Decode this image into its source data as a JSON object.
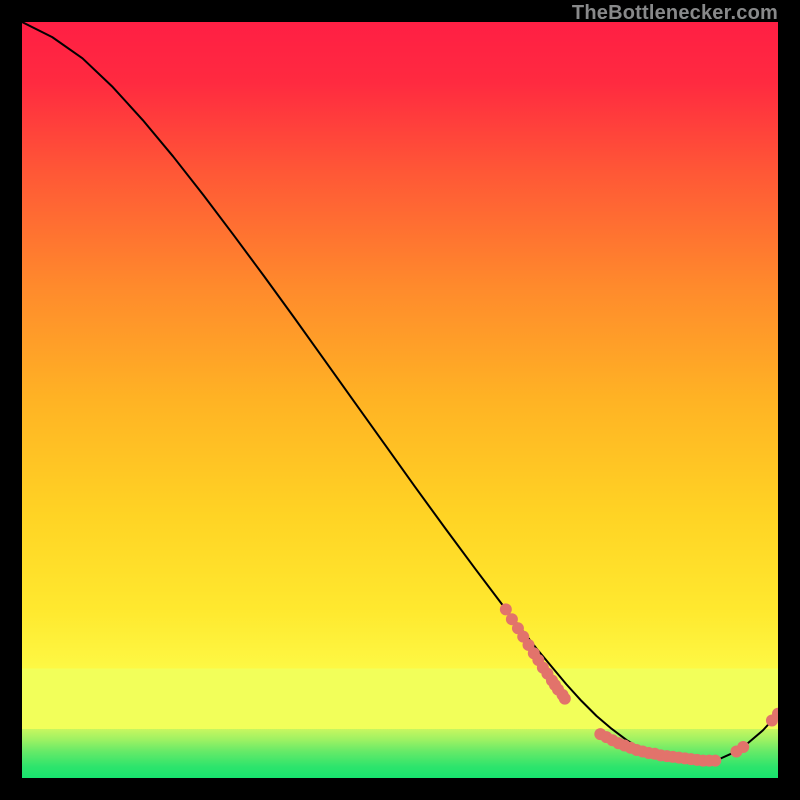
{
  "attribution": "TheBottlenecker.com",
  "chart_data": {
    "type": "line",
    "title": "",
    "xlabel": "",
    "ylabel": "",
    "xlim": [
      0,
      100
    ],
    "ylim": [
      0,
      100
    ],
    "grid": false,
    "background_gradient": {
      "top_color": "#ff1f44",
      "mid_color": "#ffd324",
      "low_band_color": "#f2ff5a",
      "bottom_color": "#17e36e"
    },
    "series": [
      {
        "name": "bottleneck-curve",
        "color": "#000000",
        "x": [
          0,
          4,
          8,
          12,
          16,
          20,
          24,
          28,
          32,
          36,
          40,
          44,
          48,
          52,
          56,
          60,
          64,
          68,
          72,
          74,
          76,
          78,
          80,
          82,
          84,
          86,
          88,
          90,
          92,
          94,
          96,
          98,
          100
        ],
        "y": [
          100,
          98.0,
          95.2,
          91.4,
          87.0,
          82.2,
          77.1,
          71.8,
          66.4,
          60.9,
          55.3,
          49.7,
          44.1,
          38.5,
          33.0,
          27.6,
          22.3,
          17.2,
          12.4,
          10.2,
          8.2,
          6.5,
          5.0,
          3.8,
          2.9,
          2.3,
          2.0,
          2.0,
          2.4,
          3.3,
          4.6,
          6.3,
          8.5
        ]
      },
      {
        "name": "highlight-dots-left-cluster",
        "type": "scatter",
        "color": "#e2736b",
        "x": [
          64.0,
          64.8,
          65.6,
          66.3,
          67.0,
          67.7,
          68.3,
          68.9,
          69.5,
          70.1,
          70.5,
          70.9
        ],
        "y": [
          22.3,
          21.0,
          19.8,
          18.7,
          17.6,
          16.5,
          15.6,
          14.6,
          13.8,
          12.9,
          12.3,
          11.7
        ]
      },
      {
        "name": "highlight-dots-upper-pair",
        "type": "scatter",
        "color": "#e2736b",
        "x": [
          71.5,
          71.8
        ],
        "y": [
          11.0,
          10.5
        ]
      },
      {
        "name": "highlight-dots-bottom-run",
        "type": "scatter",
        "color": "#e2736b",
        "x": [
          76.5,
          77.3,
          78.1,
          78.9,
          79.7,
          80.5,
          81.3,
          82.1,
          82.9,
          83.7,
          84.5,
          85.3,
          86.1,
          86.9,
          87.7,
          88.5,
          89.3,
          90.1,
          90.9,
          91.7
        ],
        "y": [
          5.8,
          5.4,
          5.0,
          4.6,
          4.3,
          4.0,
          3.7,
          3.5,
          3.3,
          3.2,
          3.0,
          2.9,
          2.8,
          2.7,
          2.6,
          2.5,
          2.4,
          2.3,
          2.3,
          2.3
        ]
      },
      {
        "name": "highlight-dots-right-pair",
        "type": "scatter",
        "color": "#e2736b",
        "x": [
          94.5,
          95.4
        ],
        "y": [
          3.5,
          4.1
        ]
      },
      {
        "name": "highlight-dots-far-right",
        "type": "scatter",
        "color": "#e2736b",
        "x": [
          99.2,
          100.0
        ],
        "y": [
          7.6,
          8.5
        ]
      }
    ]
  }
}
